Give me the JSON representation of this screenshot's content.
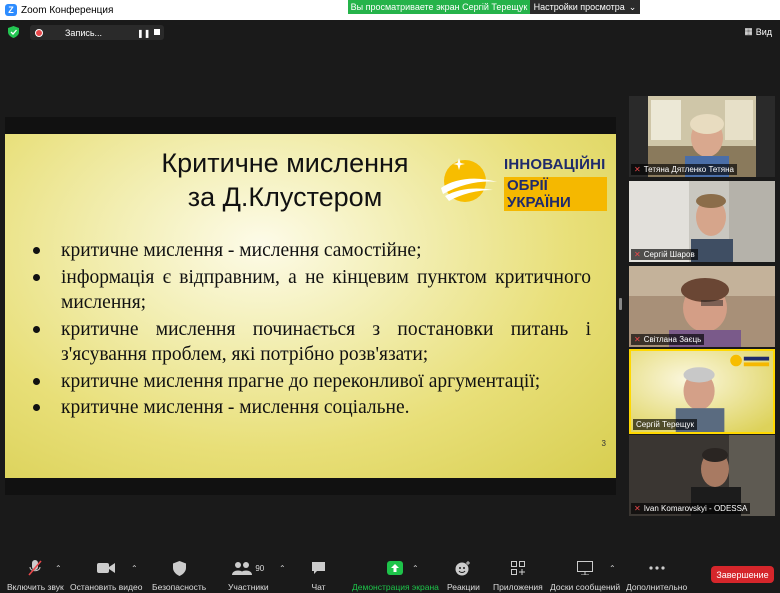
{
  "window": {
    "title": "Zoom Конференция"
  },
  "share_banner": {
    "text": "Вы просматриваете экран Сергій Терещук",
    "view_options": "Настройки просмотра"
  },
  "topbar": {
    "recording_label": "Запись...",
    "view_label": "Вид"
  },
  "slide": {
    "title_line1": "Критичне мислення",
    "title_line2": "за Д.Клустером",
    "brand_line1": "ІННОВАЦІЙНІ",
    "brand_line2": "ОБРІЇ УКРАЇНИ",
    "bullets": [
      "критичне мислення - мислення самостійне;",
      "інформація є відправним, а не кінцевим пунктом критичного мислення;",
      "критичне мислення починається з постановки питань і з'ясування проблем, які потрібно розв'язати;",
      "критичне мислення прагне до переконливої аргументації;",
      "критичне мислення - мислення соціальне."
    ],
    "page_number": "3"
  },
  "participants": [
    {
      "name": "Тетяна Дятленко Тетяна",
      "muted": true
    },
    {
      "name": "Сергій Шаров",
      "muted": true
    },
    {
      "name": "Світлана Заєць",
      "muted": true
    },
    {
      "name": "Сергій Терещук",
      "muted": false,
      "active": true
    },
    {
      "name": "Ivan Komarovskyi - ODESSA",
      "muted": true
    }
  ],
  "toolbar": {
    "unmute": "Включить звук",
    "stop_video": "Остановить видео",
    "security": "Безопасность",
    "participants": "Участники",
    "participants_count": "90",
    "chat": "Чат",
    "share_screen": "Демонстрация экрана",
    "reactions": "Реакции",
    "apps": "Приложения",
    "whiteboards": "Доски сообщений",
    "more": "Дополнительно",
    "end": "Завершение"
  },
  "colors": {
    "share_green": "#25b34a",
    "end_red": "#d5262b",
    "active_speaker": "#ffd800"
  }
}
